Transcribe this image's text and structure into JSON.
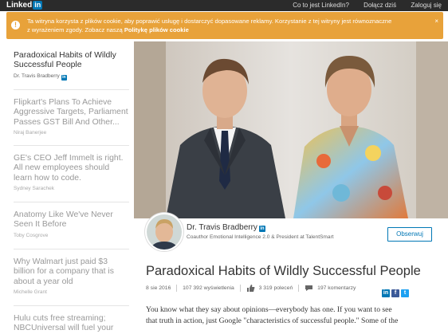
{
  "topbar": {
    "logo_text": "Linked",
    "logo_badge": "in",
    "nav": [
      "Co to jest LinkedIn?",
      "Dołącz dziś",
      "Zaloguj się"
    ]
  },
  "cookie": {
    "text_line1": "Ta witryna korzysta z plików cookie, aby poprawić usługę i dostarczyć dopasowane reklamy. Korzystanie z tej witryny jest równoznaczne",
    "text_line2": "z wyrażeniem zgody. Zobacz naszą ",
    "link": "Politykę plików cookie",
    "close": "×"
  },
  "sidebar": {
    "items": [
      {
        "title": "Paradoxical Habits of Wildly Successful People",
        "author": "Dr. Travis Bradberry",
        "badge": "in",
        "active": true
      },
      {
        "title": "Flipkart's Plans To Achieve Aggressive Targets, Parliament Passes GST Bill And Other...",
        "author": "Niraj Banerjee"
      },
      {
        "title": "GE's CEO Jeff Immelt is right. All new employees should learn how to code.",
        "author": "Sydney Sarachek"
      },
      {
        "title": "Anatomy Like We've Never Seen It Before",
        "author": "Toby Cosgrove"
      },
      {
        "title": "Why Walmart just paid $3 billion for a company that is about a year old",
        "author": "Michelle Grant"
      },
      {
        "title": "Hulu cuts free streaming; NBCUniversal will fuel your",
        "author": ""
      }
    ]
  },
  "author": {
    "name": "Dr. Travis Bradberry",
    "badge": "in",
    "title": "Coauthor Emotional Intelligence 2.0 & President at TalentSmart",
    "follow_label": "Obserwuj"
  },
  "article": {
    "title": "Paradoxical Habits of Wildly Successful People",
    "date": "8 sie 2016",
    "views": "107 392 wyświetlenia",
    "likes": "3 319 poleceń",
    "comments": "197 komentarzy",
    "share": [
      "in",
      "f",
      "t"
    ],
    "body_line1": "You know what they say about opinions—everybody has one. If you want to see",
    "body_line2": "that truth in action, just Google \"characteristics of successful people.\" Some of the"
  },
  "colors": {
    "topbar": "#2b2b2b",
    "cookie": "#e8a23a",
    "linkedin_blue": "#0077b5"
  }
}
